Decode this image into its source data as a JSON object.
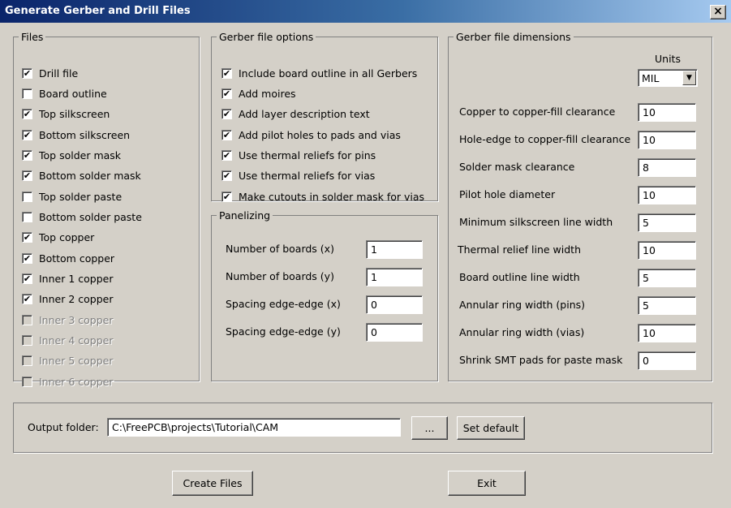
{
  "window": {
    "title": "Generate Gerber and Drill Files",
    "close_icon": "×"
  },
  "files": {
    "title": "Files",
    "items": [
      {
        "label": "Drill file",
        "checked": true,
        "enabled": true
      },
      {
        "label": "Board outline",
        "checked": false,
        "enabled": true
      },
      {
        "label": "Top silkscreen",
        "checked": true,
        "enabled": true
      },
      {
        "label": "Bottom silkscreen",
        "checked": true,
        "enabled": true
      },
      {
        "label": "Top solder mask",
        "checked": true,
        "enabled": true
      },
      {
        "label": "Bottom solder mask",
        "checked": true,
        "enabled": true
      },
      {
        "label": "Top solder paste",
        "checked": false,
        "enabled": true
      },
      {
        "label": "Bottom solder paste",
        "checked": false,
        "enabled": true
      },
      {
        "label": "Top copper",
        "checked": true,
        "enabled": true
      },
      {
        "label": "Bottom copper",
        "checked": true,
        "enabled": true
      },
      {
        "label": "Inner 1 copper",
        "checked": true,
        "enabled": true
      },
      {
        "label": "Inner 2 copper",
        "checked": true,
        "enabled": true
      },
      {
        "label": "Inner 3 copper",
        "checked": false,
        "enabled": false
      },
      {
        "label": "Inner 4 copper",
        "checked": false,
        "enabled": false
      },
      {
        "label": "Inner 5 copper",
        "checked": false,
        "enabled": false
      },
      {
        "label": "Inner 6 copper",
        "checked": false,
        "enabled": false
      }
    ]
  },
  "options": {
    "title": "Gerber file options",
    "items": [
      {
        "label": "Include board outline in all Gerbers",
        "checked": true
      },
      {
        "label": "Add moires",
        "checked": true
      },
      {
        "label": "Add layer description text",
        "checked": true
      },
      {
        "label": "Add pilot holes to pads and vias",
        "checked": true
      },
      {
        "label": "Use thermal reliefs for pins",
        "checked": true
      },
      {
        "label": "Use thermal reliefs for vias",
        "checked": true
      },
      {
        "label": "Make cutouts in solder mask for vias",
        "checked": true
      }
    ]
  },
  "panelizing": {
    "title": "Panelizing",
    "rows": [
      {
        "label": "Number of boards (x)",
        "value": "1"
      },
      {
        "label": "Number of boards (y)",
        "value": "1"
      },
      {
        "label": "Spacing edge-edge (x)",
        "value": "0"
      },
      {
        "label": "Spacing edge-edge (y)",
        "value": "0"
      }
    ]
  },
  "dimensions": {
    "title": "Gerber file dimensions",
    "units_label": "Units",
    "units_value": "MIL",
    "rows": [
      {
        "label": "Copper to copper-fill clearance",
        "value": "10"
      },
      {
        "label": "Hole-edge to copper-fill clearance",
        "value": "10"
      },
      {
        "label": "Solder mask clearance",
        "value": "8"
      },
      {
        "label": "Pilot hole diameter",
        "value": "10"
      },
      {
        "label": "Minimum silkscreen line width",
        "value": "5"
      },
      {
        "label": "Thermal relief line width",
        "value": "10"
      },
      {
        "label": "Board outline line width",
        "value": "5"
      },
      {
        "label": "Annular ring width (pins)",
        "value": "5"
      },
      {
        "label": "Annular ring width (vias)",
        "value": "10"
      },
      {
        "label": "Shrink SMT pads for paste mask",
        "value": "0"
      }
    ]
  },
  "output": {
    "label": "Output folder:",
    "value": "C:\\FreePCB\\projects\\Tutorial\\CAM",
    "browse_label": "...",
    "set_default_label": "Set default"
  },
  "actions": {
    "create_label": "Create Files",
    "exit_label": "Exit"
  }
}
